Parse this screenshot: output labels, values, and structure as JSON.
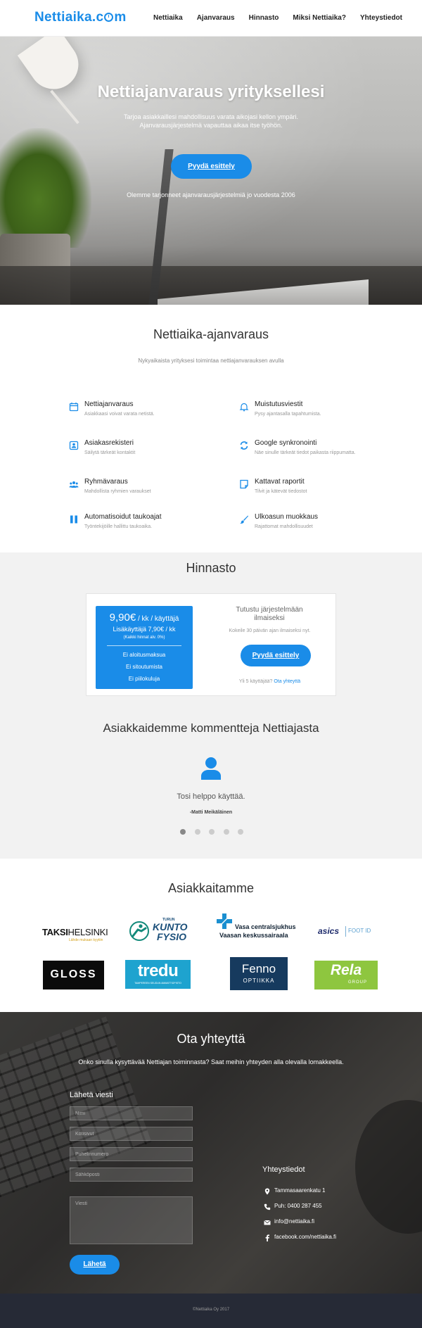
{
  "header": {
    "logo_pre": "Nettiaika.c",
    "logo_post": "m",
    "nav": [
      "Nettiaika",
      "Ajanvaraus",
      "Hinnasto",
      "Miksi Nettiaika?",
      "Yhteystiedot"
    ]
  },
  "hero": {
    "title": "Nettiajanvaraus yrityksellesi",
    "subtitle": "Tarjoa asiakkaillesi mahdollisuus varata aikojasi kellon ympäri. Ajanvarausjärjestelmä vapauttaa aikaa itse työhön.",
    "cta": "Pyydä esittely",
    "since": "Olemme tarjonneet ajanvarausjärjestelmiä jo vuodesta 2006"
  },
  "features": {
    "title": "Nettiaika-ajanvaraus",
    "lead": "Nykyaikaista yrityksesi toimintaa nettiajanvarauksen avulla",
    "items": [
      {
        "title": "Nettiajanvaraus",
        "desc": "Asiakkaasi voivat varata netistä.",
        "icon": "calendar-icon"
      },
      {
        "title": "Muistutusviestit",
        "desc": "Pysy ajantasalla tapahtumista.",
        "icon": "bell-icon"
      },
      {
        "title": "Asiakasrekisteri",
        "desc": "Säilytä tärkeät kontaktit",
        "icon": "contact-card-icon"
      },
      {
        "title": "Google synkronointi",
        "desc": "Näe sinulle tärkeät tiedot paikasta riippumatta.",
        "icon": "sync-icon"
      },
      {
        "title": "Ryhmävaraus",
        "desc": "Mahdollista ryhmien varaukset",
        "icon": "group-icon"
      },
      {
        "title": "Kattavat raportit",
        "desc": "Tilvit ja kätevät tiedostot",
        "icon": "report-icon"
      },
      {
        "title": "Automatisoidut taukoajat",
        "desc": "Työntekijöille hallittu taukoaika.",
        "icon": "pause-icon"
      },
      {
        "title": "Ulkoasun muokkaus",
        "desc": "Rajattomat mahdollisuudet",
        "icon": "brush-icon"
      }
    ]
  },
  "pricing": {
    "title": "Hinnasto",
    "price": "9,90€",
    "price_unit": " / kk / käyttäjä",
    "extra": "Lisäkäyttäjä 7,90€ / kk",
    "vat": "(Kaikki hinnat alv. 0%)",
    "perks": [
      "Ei aloitusmaksua",
      "Ei sitoutumista",
      "Ei piilokuluja"
    ],
    "try_title": "Tutustu järjestelmään ilmaiseksi",
    "try_desc": "Kokeile 30 päivän ajan ilmaiseksi nyt.",
    "cta": "Pyydä esittely",
    "five_users": "Yli 5 käyttäjää?",
    "contact_link": "Ota yhteyttä"
  },
  "testimonials": {
    "title": "Asiakkaidemme kommentteja Nettiajasta",
    "quote": "Tosi helppo käyttää.",
    "author": "-Matti Meikäläinen",
    "dots": 5,
    "active_dot": 1
  },
  "clients": {
    "title": "Asiakkaitamme",
    "logos": {
      "taksi_a": "TAKSI",
      "taksi_b": "HELSINKI",
      "taksi_tag": "Lähde mukaan kyytiin",
      "kunto_top": "TURUN",
      "kunto_a": "KUNTO",
      "kunto_b": "FYSIO",
      "vasa_a": "Vasa centralsjukhus",
      "vasa_b": "Vaasan keskussairaala",
      "asics": "asics",
      "asics_b": "FOOT ID",
      "gloss": "GLOSS",
      "tredu": "tredu",
      "tredu_sub": "TAMPEREEN SEUDUN AMMATTIOPISTO",
      "fenno_a": "Fenno",
      "fenno_b": "OPTIIKKA",
      "rela_a": "Rela",
      "rela_b": "GROUP"
    }
  },
  "contact": {
    "title": "Ota yhteyttä",
    "lead": "Onko sinulla kysyttävää Nettiajan toiminnasta? Saat meihin yhteyden alla olevalla lomakkeella.",
    "form_title": "Lähetä viesti",
    "placeholders": {
      "name": "Nimi",
      "company": "Kotisivut",
      "phone": "Puhelinnumero",
      "email": "Sähköposti",
      "message": "Viesti"
    },
    "send": "Lähetä",
    "info_title": "Yhteystiedot",
    "address": "Tammasaarenkatu 1",
    "phone": "Puh: 0400 287 455",
    "email": "info@nettiaika.fi",
    "facebook": "facebook.com/nettiaika.fi"
  },
  "footer": {
    "copyright": "©Nettiaika Oy 2017"
  },
  "colors": {
    "accent": "#1a8ce8",
    "footer": "#262a36",
    "section_gray": "#f2f2f2"
  }
}
